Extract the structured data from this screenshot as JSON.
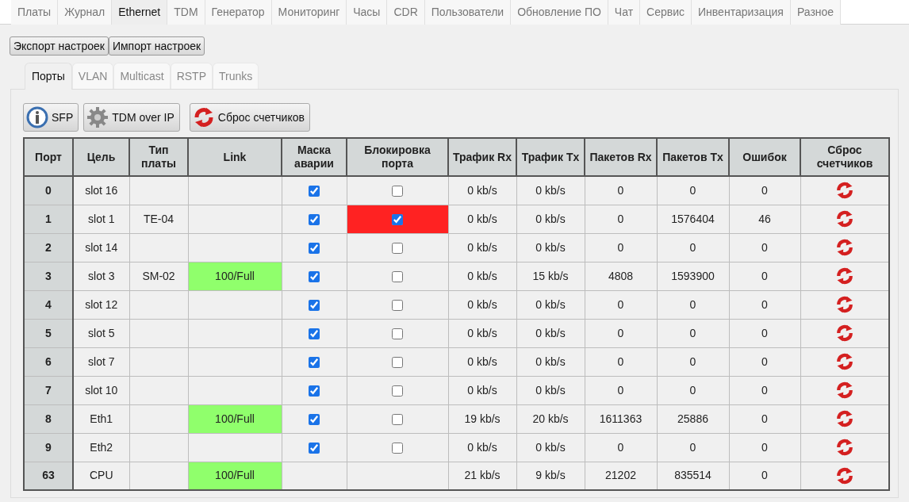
{
  "tabs": [
    {
      "label": "Платы",
      "selected": false
    },
    {
      "label": "Журнал",
      "selected": false
    },
    {
      "label": "Ethernet",
      "selected": true
    },
    {
      "label": "TDM",
      "selected": false
    },
    {
      "label": "Генератор",
      "selected": false
    },
    {
      "label": "Мониторинг",
      "selected": false
    },
    {
      "label": "Часы",
      "selected": false
    },
    {
      "label": "CDR",
      "selected": false
    },
    {
      "label": "Пользователи",
      "selected": false
    },
    {
      "label": "Обновление ПО",
      "selected": false
    },
    {
      "label": "Чат",
      "selected": false
    },
    {
      "label": "Сервис",
      "selected": false
    },
    {
      "label": "Инвентаризация",
      "selected": false
    },
    {
      "label": "Разное",
      "selected": false
    }
  ],
  "settings_buttons": [
    "Экспорт настроек",
    "Импорт настроек"
  ],
  "subtabs": [
    {
      "label": "Порты",
      "selected": true
    },
    {
      "label": "VLAN",
      "selected": false
    },
    {
      "label": "Multicast",
      "selected": false
    },
    {
      "label": "RSTP",
      "selected": false
    },
    {
      "label": "Trunks",
      "selected": false
    }
  ],
  "toolbar": [
    {
      "kind": "info",
      "label": "SFP"
    },
    {
      "kind": "gear",
      "label": "TDM over IP"
    },
    {
      "kind": "reset",
      "label": "Сброс счетчиков"
    }
  ],
  "table": {
    "columns": [
      "Порт",
      "Цель",
      "Тип платы",
      "Link",
      "Маска аварии",
      "Блокировка порта",
      "Трафик Rx",
      "Трафик Tx",
      "Пакетов Rx",
      "Пакетов Tx",
      "Ошибок",
      "Сброс счетчиков"
    ],
    "rows": [
      {
        "port": "0",
        "target": "slot 16",
        "mask": true,
        "blocked": false,
        "rx": "0 kb/s",
        "tx": "0 kb/s",
        "prx": "0",
        "ptx": "0",
        "errors": "0"
      },
      {
        "port": "1",
        "target": "slot 1",
        "board": "TE-04",
        "mask": true,
        "blocked": true,
        "rx": "0 kb/s",
        "tx": "0 kb/s",
        "prx": "0",
        "ptx": "1576404",
        "errors": "46"
      },
      {
        "port": "2",
        "target": "slot 14",
        "mask": true,
        "blocked": false,
        "rx": "0 kb/s",
        "tx": "0 kb/s",
        "prx": "0",
        "ptx": "0",
        "errors": "0"
      },
      {
        "port": "3",
        "target": "slot 3",
        "board": "SM-02",
        "link": "100/Full",
        "mask": true,
        "blocked": false,
        "rx": "0 kb/s",
        "tx": "15 kb/s",
        "prx": "4808",
        "ptx": "1593900",
        "errors": "0"
      },
      {
        "port": "4",
        "target": "slot 12",
        "mask": true,
        "blocked": false,
        "rx": "0 kb/s",
        "tx": "0 kb/s",
        "prx": "0",
        "ptx": "0",
        "errors": "0"
      },
      {
        "port": "5",
        "target": "slot 5",
        "mask": true,
        "blocked": false,
        "rx": "0 kb/s",
        "tx": "0 kb/s",
        "prx": "0",
        "ptx": "0",
        "errors": "0"
      },
      {
        "port": "6",
        "target": "slot 7",
        "mask": true,
        "blocked": false,
        "rx": "0 kb/s",
        "tx": "0 kb/s",
        "prx": "0",
        "ptx": "0",
        "errors": "0"
      },
      {
        "port": "7",
        "target": "slot 10",
        "mask": true,
        "blocked": false,
        "rx": "0 kb/s",
        "tx": "0 kb/s",
        "prx": "0",
        "ptx": "0",
        "errors": "0"
      },
      {
        "port": "8",
        "target": "Eth1",
        "link": "100/Full",
        "mask": true,
        "blocked": false,
        "rx": "19 kb/s",
        "tx": "20 kb/s",
        "prx": "1611363",
        "ptx": "25886",
        "errors": "0"
      },
      {
        "port": "9",
        "target": "Eth2",
        "mask": true,
        "blocked": false,
        "rx": "0 kb/s",
        "tx": "0 kb/s",
        "prx": "0",
        "ptx": "0",
        "errors": "0"
      },
      {
        "port": "63",
        "target": "CPU",
        "link": "100/Full",
        "rx": "21 kb/s",
        "tx": "9 kb/s",
        "prx": "21202",
        "ptx": "835514",
        "errors": "0"
      }
    ]
  }
}
